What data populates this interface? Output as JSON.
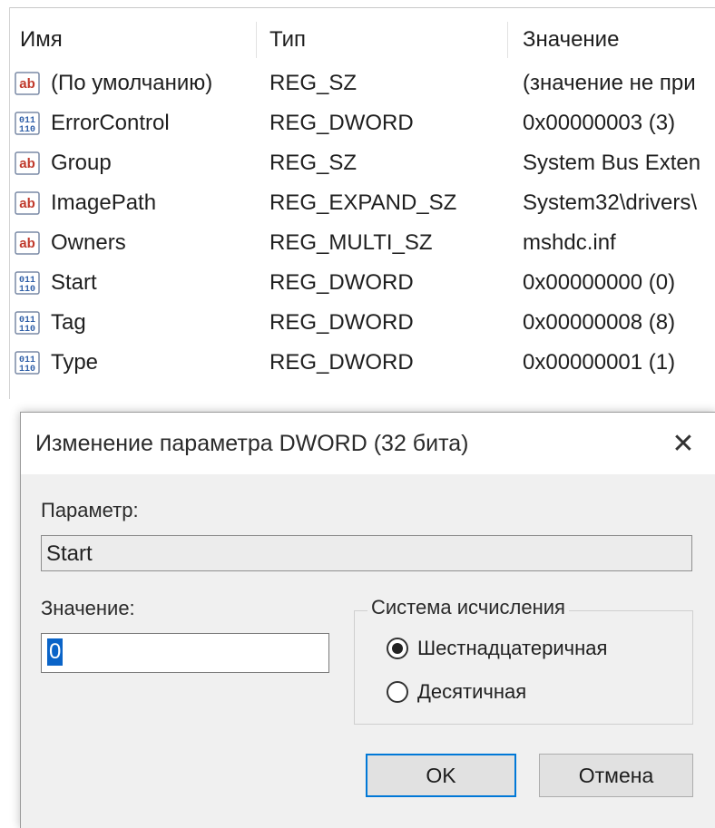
{
  "registry": {
    "columns": {
      "name": "Имя",
      "type": "Тип",
      "value": "Значение"
    },
    "rows": [
      {
        "icon": "string-value-icon",
        "name": "(По умолчанию)",
        "type": "REG_SZ",
        "value": "(значение не при"
      },
      {
        "icon": "binary-value-icon",
        "name": "ErrorControl",
        "type": "REG_DWORD",
        "value": "0x00000003 (3)"
      },
      {
        "icon": "string-value-icon",
        "name": "Group",
        "type": "REG_SZ",
        "value": "System Bus Exten"
      },
      {
        "icon": "string-value-icon",
        "name": "ImagePath",
        "type": "REG_EXPAND_SZ",
        "value": "System32\\drivers\\"
      },
      {
        "icon": "string-value-icon",
        "name": "Owners",
        "type": "REG_MULTI_SZ",
        "value": "mshdc.inf"
      },
      {
        "icon": "binary-value-icon",
        "name": "Start",
        "type": "REG_DWORD",
        "value": "0x00000000 (0)"
      },
      {
        "icon": "binary-value-icon",
        "name": "Tag",
        "type": "REG_DWORD",
        "value": "0x00000008 (8)"
      },
      {
        "icon": "binary-value-icon",
        "name": "Type",
        "type": "REG_DWORD",
        "value": "0x00000001 (1)"
      }
    ]
  },
  "dialog": {
    "title": "Изменение параметра DWORD (32 бита)",
    "close_glyph": "✕",
    "param_label": "Параметр:",
    "param_value": "Start",
    "value_label": "Значение:",
    "value_input": "0",
    "base_group_label": "Система исчисления",
    "radio_hex": "Шестнадцатеричная",
    "radio_dec": "Десятичная",
    "selected_base": "hex",
    "ok_label": "OK",
    "cancel_label": "Отмена"
  },
  "colors": {
    "accent": "#0078d7",
    "selection": "#0a64c8"
  }
}
